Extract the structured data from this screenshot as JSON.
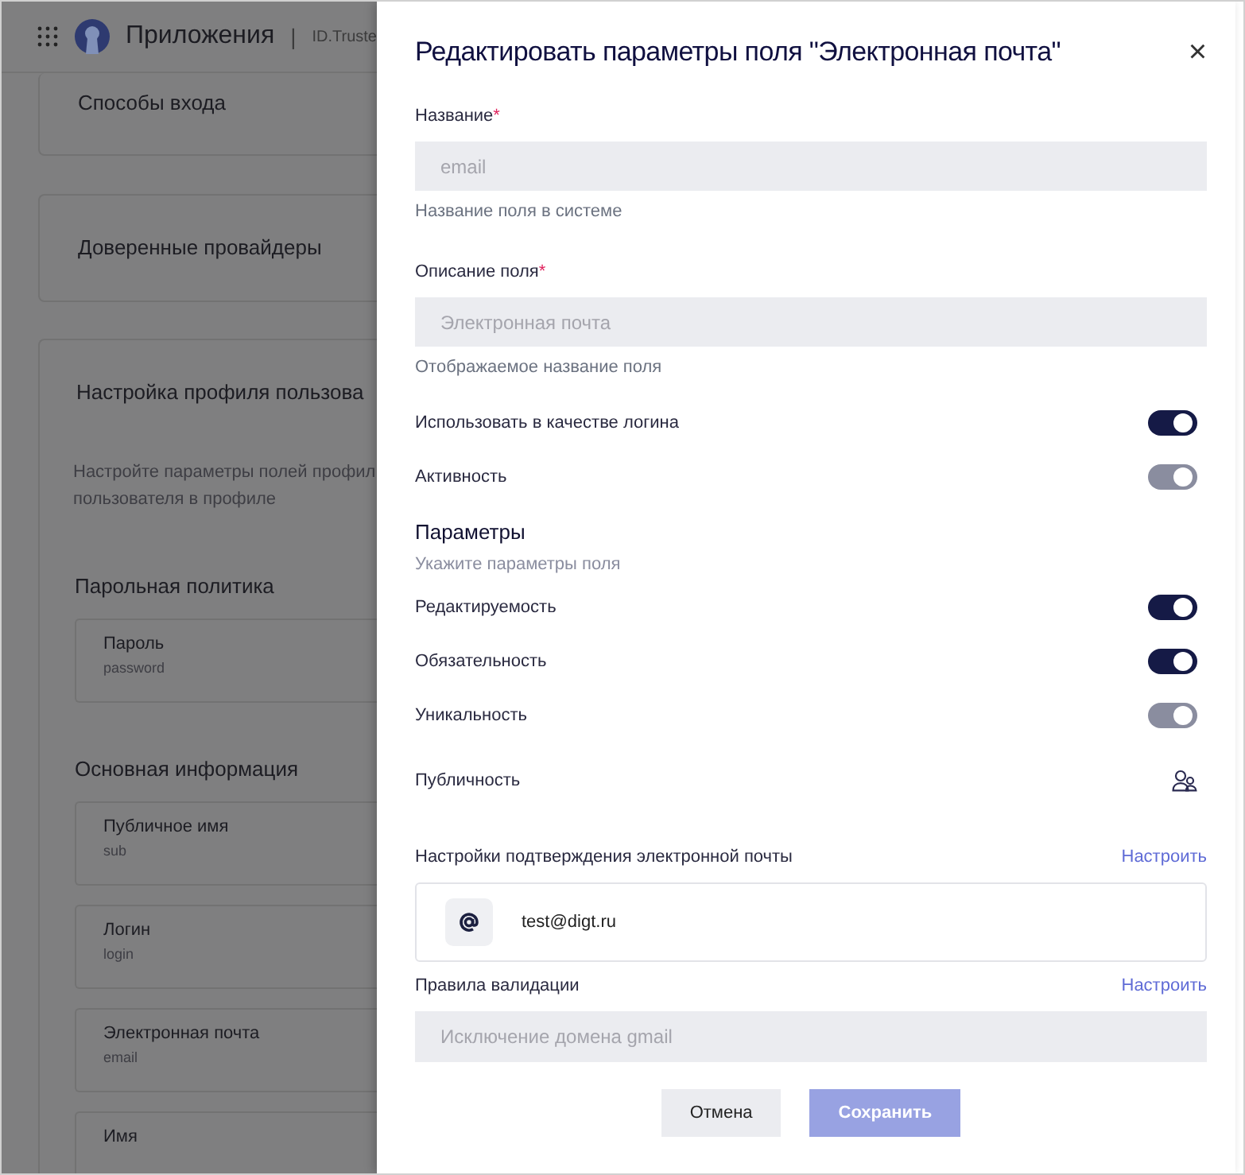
{
  "header": {
    "app_title": "Приложения",
    "separator": "|",
    "subtitle": "ID.Truste"
  },
  "background_sections": [
    {
      "title": "Способы входа"
    },
    {
      "title": "Доверенные провайдеры"
    }
  ],
  "profile_card": {
    "title": "Настройка профиля пользова",
    "description": [
      "Настройте параметры полей профил",
      "пользователя в профиле"
    ],
    "groups": [
      {
        "title": "Парольная политика",
        "fields": [
          {
            "name": "Пароль",
            "key": "password"
          }
        ]
      },
      {
        "title": "Основная информация",
        "fields": [
          {
            "name": "Публичное имя",
            "key": "sub"
          },
          {
            "name": "Логин",
            "key": "login"
          },
          {
            "name": "Электронная почта",
            "key": "email"
          },
          {
            "name": "Имя"
          }
        ]
      }
    ]
  },
  "drawer": {
    "title": "Редактировать параметры поля \"Электронная почта\"",
    "close": "×",
    "inputs": [
      {
        "label": "Название",
        "required_mark": "*",
        "value": "email",
        "hint": "Название поля в системе"
      },
      {
        "label": "Описание поля",
        "required_mark": "*",
        "value": "Электронная почта",
        "hint": "Отображаемое название поля"
      }
    ],
    "options": [
      {
        "kind": "toggle",
        "label": "Использовать в качестве логина",
        "on": true,
        "disabled": false
      },
      {
        "kind": "toggle",
        "label": "Активность",
        "on": true,
        "disabled": true
      }
    ],
    "parameters": {
      "title": "Параметры",
      "subtitle": "Укажите параметры поля",
      "rows": [
        {
          "kind": "toggle",
          "label": "Редактируемость",
          "on": true,
          "disabled": false
        },
        {
          "kind": "toggle",
          "label": "Обязательность",
          "on": true,
          "disabled": false
        },
        {
          "kind": "toggle",
          "label": "Уникальность",
          "on": true,
          "disabled": true
        },
        {
          "kind": "icon",
          "label": "Публичность"
        }
      ]
    },
    "email_confirmation": {
      "label": "Настройки подтверждения электронной почты",
      "action": "Настроить",
      "email": "test@digt.ru"
    },
    "validation": {
      "label": "Правила валидации",
      "action": "Настроить",
      "value": "Исключение домена gmail"
    },
    "buttons": [
      {
        "kind": "secondary",
        "label": "Отмена"
      },
      {
        "kind": "primary",
        "label": "Сохранить"
      }
    ]
  }
}
